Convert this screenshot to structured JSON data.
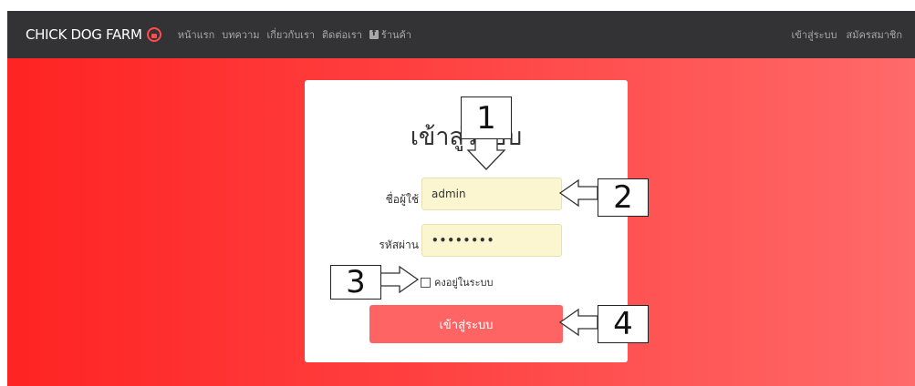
{
  "navbar": {
    "brand": "CHICK DOG FARM",
    "links": [
      "หน้าแรก",
      "บทความ",
      "เกี่ยวกับเรา",
      "ติดต่อเรา",
      "ร้านค้า"
    ],
    "right_links": [
      "เข้าสู่ระบบ",
      "สมัครสมาชิก"
    ]
  },
  "login": {
    "title": "เข้าสู่ระบบ",
    "username_label": "ชื่อผู้ใช้",
    "username_value": "admin",
    "password_label": "รหัสผ่าน",
    "password_value": "••••••••",
    "remember_label": "คงอยู่ในระบบ",
    "submit_label": "เข้าสู่ระบบ"
  },
  "callouts": [
    "1",
    "2",
    "3",
    "4"
  ],
  "colors": {
    "navbar_bg": "#333235",
    "hero_left": "#ff2323",
    "hero_right": "#ff6a6a",
    "input_bg": "#fbf6cf",
    "button_bg": "#ff6464"
  }
}
